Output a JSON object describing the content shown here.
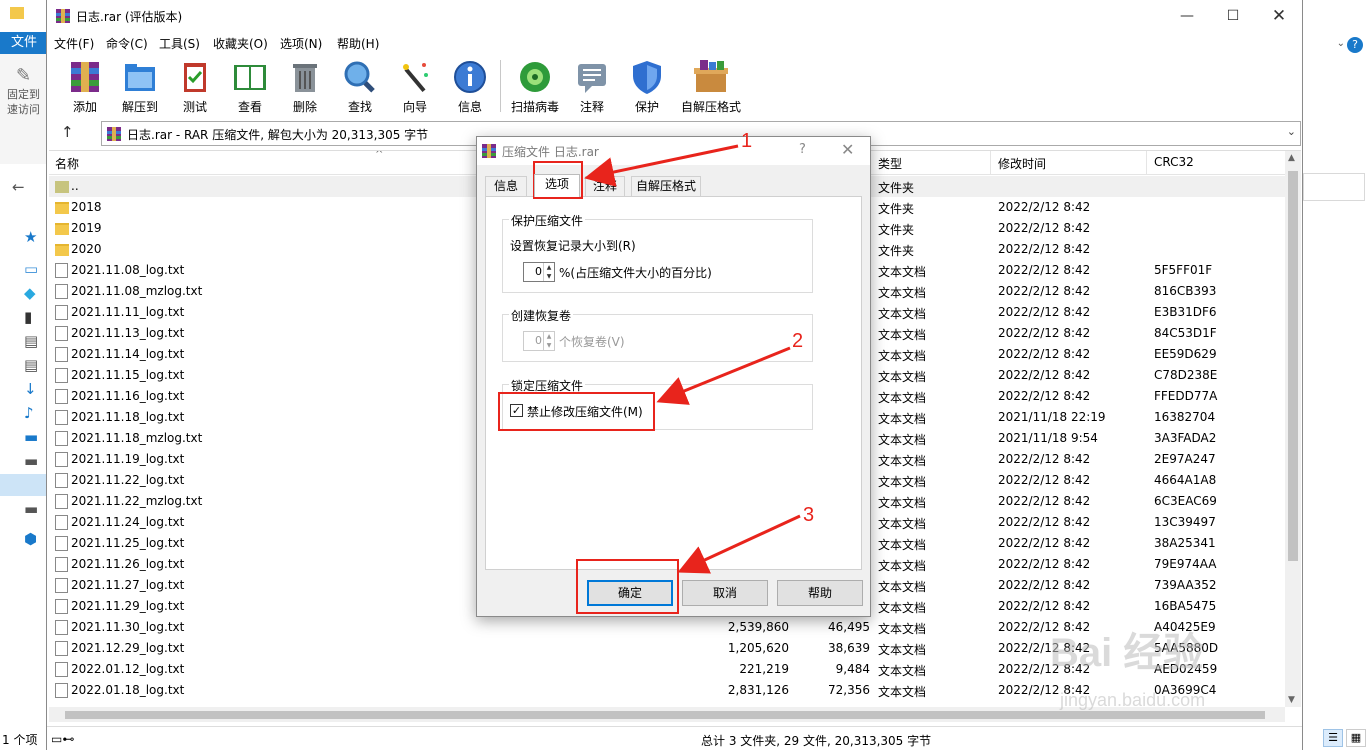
{
  "explorer": {
    "ribbon_tab": "文件",
    "pin_label": "固定到\n速访问",
    "status": "1 个项"
  },
  "winrar": {
    "title": "日志.rar (评估版本)",
    "menu": [
      "文件(F)",
      "命令(C)",
      "工具(S)",
      "收藏夹(O)",
      "选项(N)",
      "帮助(H)"
    ],
    "toolbar": [
      "添加",
      "解压到",
      "测试",
      "查看",
      "删除",
      "查找",
      "向导",
      "信息",
      "扫描病毒",
      "注释",
      "保护",
      "自解压格式"
    ],
    "address": "日志.rar - RAR 压缩文件, 解包大小为 20,313,305 字节",
    "columns": [
      "名称",
      "类型",
      "修改时间",
      "CRC32"
    ],
    "files": [
      {
        "name": "..",
        "size": "",
        "packed": "",
        "type": "文件夹",
        "modified": "",
        "crc": "",
        "icon": "parent"
      },
      {
        "name": "2018",
        "size": "",
        "packed": "",
        "type": "文件夹",
        "modified": "2022/2/12 8:42",
        "crc": "",
        "icon": "folder"
      },
      {
        "name": "2019",
        "size": "",
        "packed": "",
        "type": "文件夹",
        "modified": "2022/2/12 8:42",
        "crc": "",
        "icon": "folder"
      },
      {
        "name": "2020",
        "size": "",
        "packed": "",
        "type": "文件夹",
        "modified": "2022/2/12 8:42",
        "crc": "",
        "icon": "folder"
      },
      {
        "name": "2021.11.08_log.txt",
        "size": "",
        "packed": "",
        "type": "文本文档",
        "modified": "2022/2/12 8:42",
        "crc": "5F5FF01F",
        "icon": "doc"
      },
      {
        "name": "2021.11.08_mzlog.txt",
        "size": "",
        "packed": "",
        "type": "文本文档",
        "modified": "2022/2/12 8:42",
        "crc": "816CB393",
        "icon": "doc"
      },
      {
        "name": "2021.11.11_log.txt",
        "size": "",
        "packed": "",
        "type": "文本文档",
        "modified": "2022/2/12 8:42",
        "crc": "E3B31DF6",
        "icon": "doc"
      },
      {
        "name": "2021.11.13_log.txt",
        "size": "",
        "packed": "",
        "type": "文本文档",
        "modified": "2022/2/12 8:42",
        "crc": "84C53D1F",
        "icon": "doc"
      },
      {
        "name": "2021.11.14_log.txt",
        "size": "",
        "packed": "",
        "type": "文本文档",
        "modified": "2022/2/12 8:42",
        "crc": "EE59D629",
        "icon": "doc"
      },
      {
        "name": "2021.11.15_log.txt",
        "size": "",
        "packed": "",
        "type": "文本文档",
        "modified": "2022/2/12 8:42",
        "crc": "C78D238E",
        "icon": "doc"
      },
      {
        "name": "2021.11.16_log.txt",
        "size": "",
        "packed": "",
        "type": "文本文档",
        "modified": "2022/2/12 8:42",
        "crc": "FFEDD77A",
        "icon": "doc"
      },
      {
        "name": "2021.11.18_log.txt",
        "size": "",
        "packed": "",
        "type": "文本文档",
        "modified": "2021/11/18 22:19",
        "crc": "16382704",
        "icon": "doc"
      },
      {
        "name": "2021.11.18_mzlog.txt",
        "size": "",
        "packed": "",
        "type": "文本文档",
        "modified": "2021/11/18 9:54",
        "crc": "3A3FADA2",
        "icon": "doc"
      },
      {
        "name": "2021.11.19_log.txt",
        "size": "",
        "packed": "",
        "type": "文本文档",
        "modified": "2022/2/12 8:42",
        "crc": "2E97A247",
        "icon": "doc"
      },
      {
        "name": "2021.11.22_log.txt",
        "size": "",
        "packed": "",
        "type": "文本文档",
        "modified": "2022/2/12 8:42",
        "crc": "4664A1A8",
        "icon": "doc"
      },
      {
        "name": "2021.11.22_mzlog.txt",
        "size": "",
        "packed": "",
        "type": "文本文档",
        "modified": "2022/2/12 8:42",
        "crc": "6C3EAC69",
        "icon": "doc"
      },
      {
        "name": "2021.11.24_log.txt",
        "size": "",
        "packed": "",
        "type": "文本文档",
        "modified": "2022/2/12 8:42",
        "crc": "13C39497",
        "icon": "doc"
      },
      {
        "name": "2021.11.25_log.txt",
        "size": "",
        "packed": "",
        "type": "文本文档",
        "modified": "2022/2/12 8:42",
        "crc": "38A25341",
        "icon": "doc"
      },
      {
        "name": "2021.11.26_log.txt",
        "size": "",
        "packed": "",
        "type": "文本文档",
        "modified": "2022/2/12 8:42",
        "crc": "79E974AA",
        "icon": "doc"
      },
      {
        "name": "2021.11.27_log.txt",
        "size": "",
        "packed": "",
        "type": "文本文档",
        "modified": "2022/2/12 8:42",
        "crc": "739AA352",
        "icon": "doc"
      },
      {
        "name": "2021.11.29_log.txt",
        "size": "",
        "packed": "",
        "type": "文本文档",
        "modified": "2022/2/12 8:42",
        "crc": "16BA5475",
        "icon": "doc"
      },
      {
        "name": "2021.11.30_log.txt",
        "size": "2,539,860",
        "packed": "46,495",
        "type": "文本文档",
        "modified": "2022/2/12 8:42",
        "crc": "A40425E9",
        "icon": "doc"
      },
      {
        "name": "2021.12.29_log.txt",
        "size": "1,205,620",
        "packed": "38,639",
        "type": "文本文档",
        "modified": "2022/2/12 8:42",
        "crc": "5AA5880D",
        "icon": "doc"
      },
      {
        "name": "2022.01.12_log.txt",
        "size": "221,219",
        "packed": "9,484",
        "type": "文本文档",
        "modified": "2022/2/12 8:42",
        "crc": "AED02459",
        "icon": "doc"
      },
      {
        "name": "2022.01.18_log.txt",
        "size": "2,831,126",
        "packed": "72,356",
        "type": "文本文档",
        "modified": "2022/2/12 8:42",
        "crc": "0A3699C4",
        "icon": "doc"
      }
    ],
    "status": "总计 3 文件夹, 29 文件, 20,313,305 字节"
  },
  "dialog": {
    "title": "压缩文件 日志.rar",
    "help_glyph": "?",
    "tabs": [
      "信息",
      "选项",
      "注释",
      "自解压格式"
    ],
    "groups": {
      "protect": {
        "title": "保护压缩文件",
        "label": "设置恢复记录大小到(R)",
        "value": "0",
        "suffix": "%(占压缩文件大小的百分比)"
      },
      "volumes": {
        "title": "创建恢复卷",
        "value": "0",
        "suffix": "个恢复卷(V)"
      },
      "lock": {
        "title": "锁定压缩文件",
        "checkbox_label": "禁止修改压缩文件(M)",
        "checked": true
      }
    },
    "buttons": {
      "ok": "确定",
      "cancel": "取消",
      "help": "帮助"
    }
  },
  "annotations": [
    "1",
    "2",
    "3"
  ],
  "watermark": {
    "logo": "Bai 经验",
    "url": "jingyan.baidu.com"
  }
}
